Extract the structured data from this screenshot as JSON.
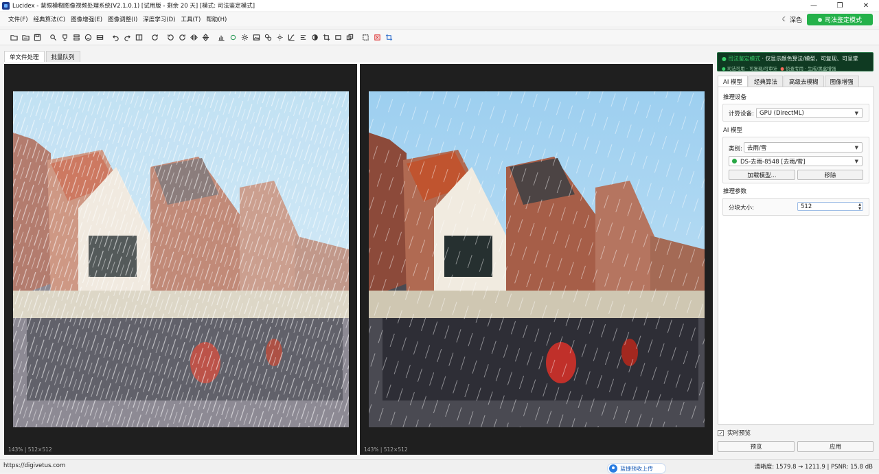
{
  "window": {
    "title": "Lucidex - 慧眼模糊图像视频处理系统(V2.1.0.1) [试用版 - 剩余 20 天] [模式: 司法鉴定模式]",
    "controls": [
      "—",
      "❐",
      "✕"
    ]
  },
  "menu": {
    "items": [
      "文件(F)",
      "经典算法(C)",
      "图像增强(E)",
      "图像调整(I)",
      "深度学习(D)",
      "工具(T)",
      "帮助(H)"
    ],
    "theme_label": "深色",
    "forensic_button": "司法鉴定模式"
  },
  "toolbar": {
    "tools": [
      "open-folder-icon",
      "open-file-icon",
      "save-icon",
      "magnifier-icon",
      "trophy-icon",
      "stack-icon",
      "face-icon",
      "layout-icon",
      "undo-icon",
      "redo-icon",
      "compare-icon",
      "refresh-icon",
      "rotate-left-icon",
      "rotate-right-icon",
      "flip-h-icon",
      "flip-v-icon",
      "histogram-icon",
      "color-icon",
      "sun-icon",
      "image-icon",
      "link-icon",
      "brightness-icon",
      "curve-icon",
      "levels-icon",
      "contrast-icon",
      "crop-icon",
      "frame-icon",
      "layers-icon",
      "select-icon",
      "clear-icon",
      "crop-alt-icon"
    ]
  },
  "doc_tabs": [
    "单文件处理",
    "批量队列"
  ],
  "viewer": {
    "left_footer": "143%  |  512×512",
    "right_footer": "143%  |  512×512"
  },
  "banner": {
    "mode": "司法鉴定模式",
    "line1_rest": " · 仅显示颜色算法/模型，可复现、可呈堂",
    "line2_a": "司法可用 · 可复现/可审计",
    "line2_b": "侦查专用 · 生成/黑盒增强"
  },
  "panel": {
    "tabs": [
      "AI 模型",
      "经典算法",
      "高级去模糊",
      "图像增强"
    ],
    "inference_device_title": "推理设备",
    "device_label": "计算设备:",
    "device_value": "GPU (DirectML)",
    "ai_model_title": "AI 模型",
    "category_label": "类别:",
    "category_value": "去雨/雪",
    "model_value": "DS-去雨-8548 [去雨/雪]",
    "load_button": "加载模型...",
    "remove_button": "移除",
    "params_title": "推理参数",
    "tile_label": "分块大小:",
    "tile_value": "512",
    "realtime_label": "实时预览",
    "realtime_checked": true,
    "preview_button": "预览",
    "apply_button": "应用"
  },
  "status": {
    "url": "https://digivetus.com",
    "upload_label": "蓝捷预收上传",
    "metrics": "清晰度: 1579.8 → 1211.9  |  PSNR: 15.8 dB"
  }
}
